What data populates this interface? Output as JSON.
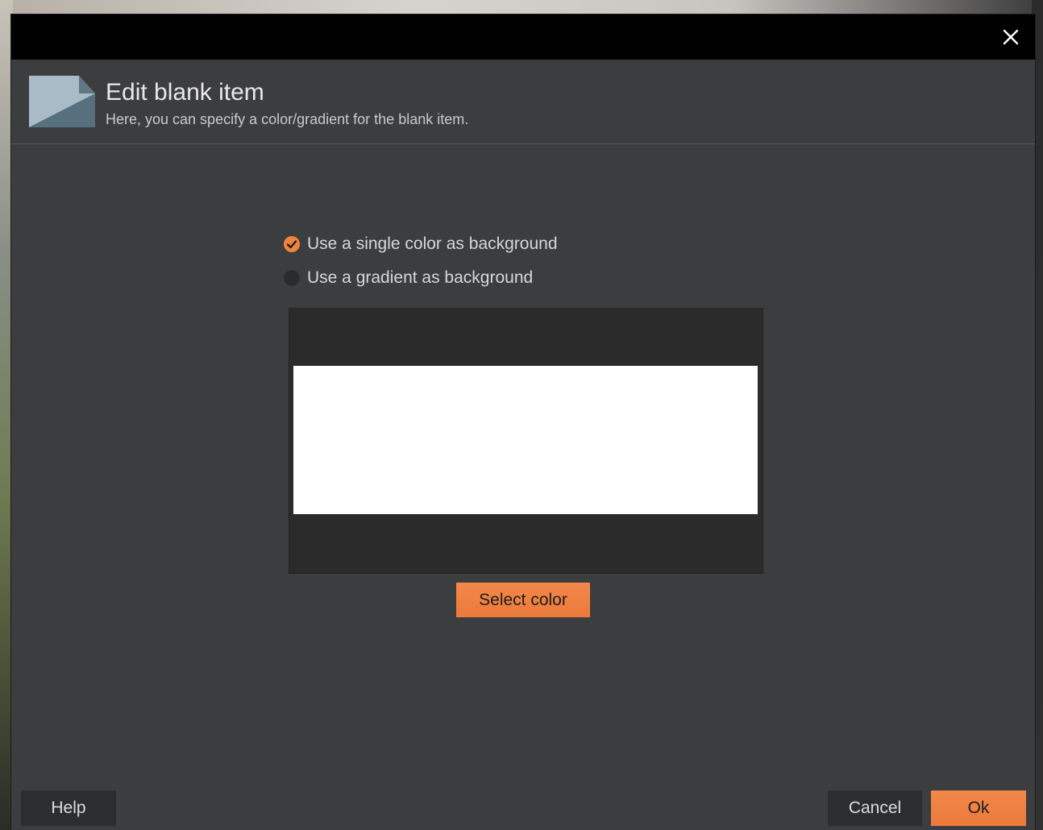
{
  "dialog": {
    "title": "Edit blank item",
    "subtitle": "Here, you can specify a color/gradient for the blank item."
  },
  "options": [
    {
      "label": "Use a single color as background",
      "checked": true
    },
    {
      "label": "Use a gradient as background",
      "checked": false
    }
  ],
  "preview": {
    "color": "#FFFFFF"
  },
  "buttons": {
    "select_color": "Select color",
    "help": "Help",
    "cancel": "Cancel",
    "ok": "Ok"
  },
  "colors": {
    "accent": "#F0843E",
    "dialog_bg": "#3C3D3F",
    "titlebar_bg": "#000000",
    "preview_frame_bg": "#2B2B2C"
  },
  "icons": {
    "close": "close-icon",
    "header": "blank-item-icon",
    "check": "checkmark-icon"
  }
}
